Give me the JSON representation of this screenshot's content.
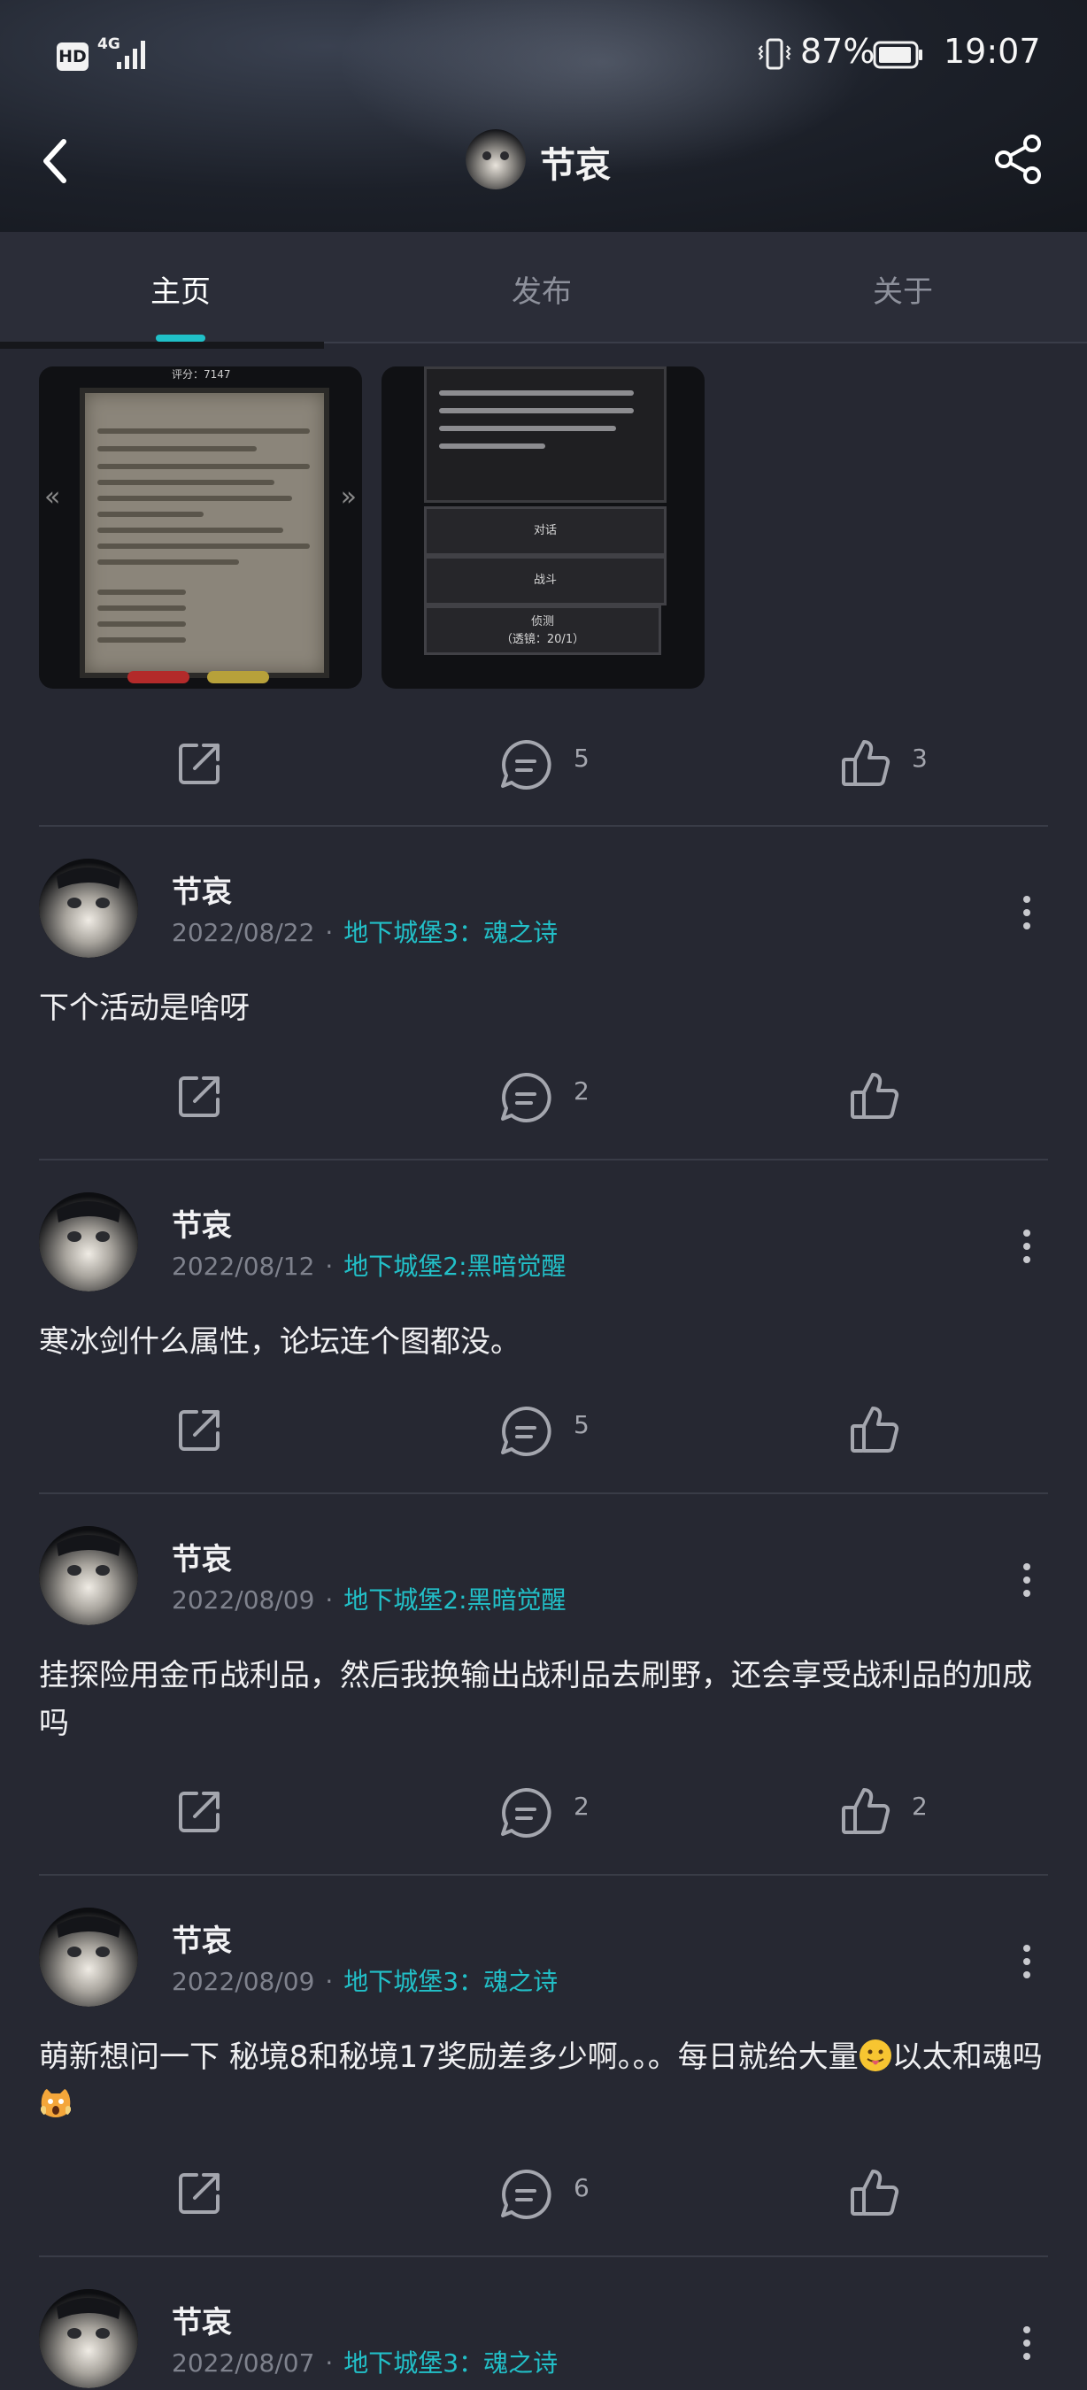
{
  "status_bar": {
    "hd": "HD",
    "network": "4G",
    "battery": "87%",
    "time": "19:07"
  },
  "header": {
    "title": "节哀"
  },
  "tabs": [
    {
      "label": "主页",
      "active": true
    },
    {
      "label": "发布",
      "active": false
    },
    {
      "label": "关于",
      "active": false
    }
  ],
  "image_strip": {
    "shot1_score": "评分：7147",
    "shot2_buttons": [
      "对话",
      "战斗",
      "侦测\n（透镜：20/1）"
    ]
  },
  "top_post_actions": {
    "comments": "5",
    "likes": "3"
  },
  "posts": [
    {
      "author": "节哀",
      "date": "2022/08/22",
      "game": "地下城堡3：魂之诗",
      "text": "下个活动是啥呀",
      "comments": "2",
      "likes": ""
    },
    {
      "author": "节哀",
      "date": "2022/08/12",
      "game": "地下城堡2:黑暗觉醒",
      "text": "寒冰剑什么属性，论坛连个图都没。",
      "comments": "5",
      "likes": ""
    },
    {
      "author": "节哀",
      "date": "2022/08/09",
      "game": "地下城堡2:黑暗觉醒",
      "text": "挂探险用金币战利品，然后我换输出战利品去刷野，还会享受战利品的加成吗",
      "comments": "2",
      "likes": "2"
    },
    {
      "author": "节哀",
      "date": "2022/08/09",
      "game": "地下城堡3：魂之诗",
      "text_a": "萌新想问一下 秘境8和秘境17奖励差多少啊。。。每日就给大量",
      "text_b": "以太和魂吗",
      "comments": "6",
      "likes": ""
    },
    {
      "author": "节哀",
      "date": "2022/08/07",
      "game": "地下城堡3：魂之诗"
    }
  ],
  "colors": {
    "accent": "#22c0c8",
    "background": "#262832",
    "muted": "#7f828d"
  },
  "icons": [
    "back-arrow-icon",
    "share-network-icon",
    "share-out-icon",
    "comment-icon",
    "like-thumb-icon",
    "more-vertical-icon"
  ]
}
